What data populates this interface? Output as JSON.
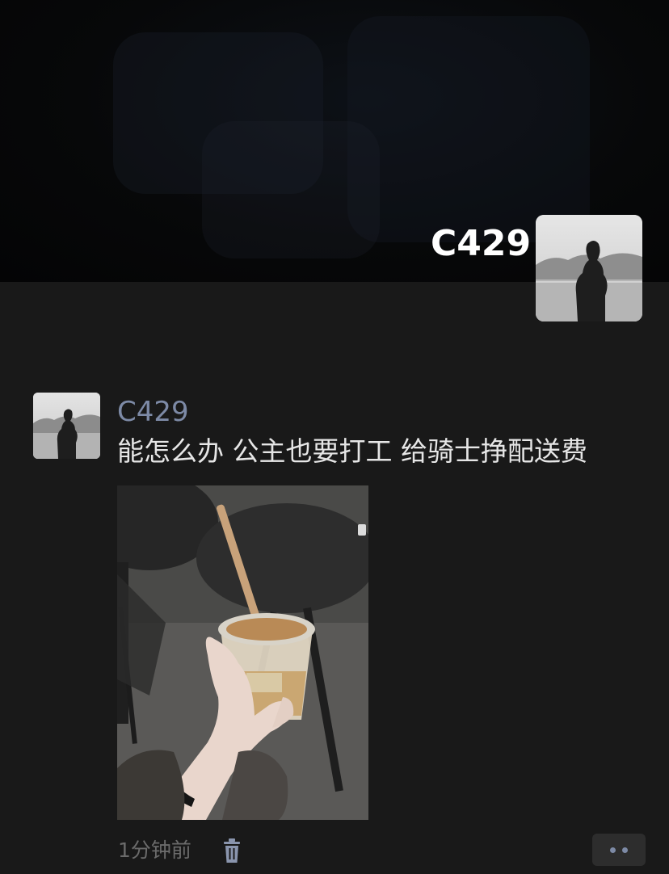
{
  "cover": {
    "username": "C429"
  },
  "post": {
    "username": "C429",
    "text": "能怎么办 公主也要打工 给骑士挣配送费",
    "time": "1分钟前"
  },
  "icons": {
    "delete": "trash-icon",
    "more": "more-options-icon"
  },
  "colors": {
    "background": "#191919",
    "username": "#7d8aa6",
    "text": "#e6e6e6",
    "time": "#6b6b6b"
  }
}
